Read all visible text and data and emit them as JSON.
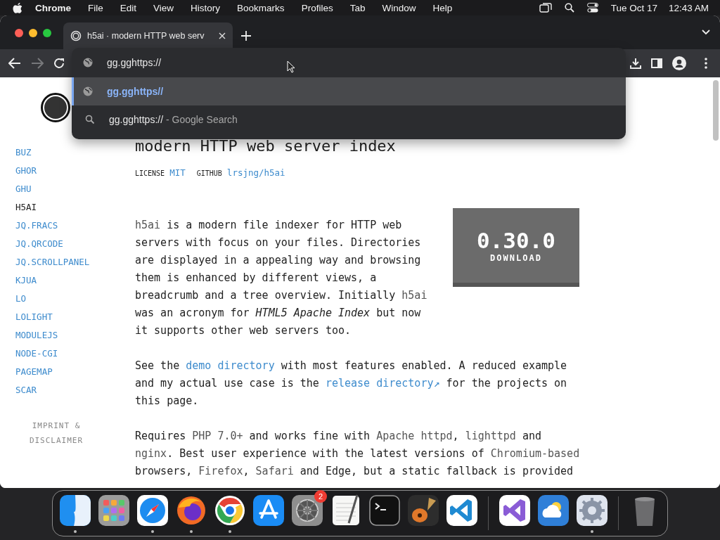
{
  "menubar": {
    "app": "Chrome",
    "menus": [
      "File",
      "Edit",
      "View",
      "History",
      "Bookmarks",
      "Profiles",
      "Tab",
      "Window",
      "Help"
    ],
    "date": "Tue Oct 17",
    "time": "12:43 AM"
  },
  "browser": {
    "tab": {
      "title": "h5ai · modern HTTP web serv",
      "selected": true
    },
    "forward_disabled": true,
    "omnibox": {
      "value": "gg.gghttps://"
    },
    "suggestions": [
      {
        "kind": "url",
        "text": "gg.gghttps//",
        "selected": true
      },
      {
        "kind": "search",
        "text": "gg.gghttps://",
        "suffix": " - Google Search",
        "selected": false
      }
    ]
  },
  "page": {
    "sidebar": {
      "items": [
        {
          "label": "BUZ",
          "selected": false
        },
        {
          "label": "GHOR",
          "selected": false
        },
        {
          "label": "GHU",
          "selected": false
        },
        {
          "label": "H5AI",
          "selected": true
        },
        {
          "label": "JQ.FRACS",
          "selected": false
        },
        {
          "label": "JQ.QRCODE",
          "selected": false
        },
        {
          "label": "JQ.SCROLLPANEL",
          "selected": false
        },
        {
          "label": "KJUA",
          "selected": false
        },
        {
          "label": "LO",
          "selected": false
        },
        {
          "label": "LOLIGHT",
          "selected": false
        },
        {
          "label": "MODULEJS",
          "selected": false
        },
        {
          "label": "NODE-CGI",
          "selected": false
        },
        {
          "label": "PAGEMAP",
          "selected": false
        },
        {
          "label": "SCAR",
          "selected": false
        }
      ],
      "footer": "IMPRINT & DISCLAIMER"
    },
    "heading": "modern HTTP web server index",
    "meta": [
      {
        "label": "LICENSE",
        "value": "MIT"
      },
      {
        "label": "GITHUB",
        "value": "lrsjng/h5ai"
      }
    ],
    "download": {
      "version": "0.30.0",
      "label": "DOWNLOAD"
    },
    "paragraphs": [
      [
        {
          "kind": "code",
          "text": "h5ai"
        },
        {
          "kind": "text",
          "text": " is a modern file indexer for HTTP web servers with focus on your files. Directories are displayed in a appealing way and browsing them is enhanced by different views, a breadcrumb and a tree overview. Initially "
        },
        {
          "kind": "code",
          "text": "h5ai"
        },
        {
          "kind": "text",
          "text": " was an acronym for "
        },
        {
          "kind": "em",
          "text": "HTML5 Apache Index"
        },
        {
          "kind": "text",
          "text": " but now it supports other web servers too."
        }
      ],
      [
        {
          "kind": "text",
          "text": "See the "
        },
        {
          "kind": "link",
          "text": "demo directory"
        },
        {
          "kind": "text",
          "text": " with most features enabled. A reduced example and my actual use case is the "
        },
        {
          "kind": "link",
          "text": "release directory↗"
        },
        {
          "kind": "text",
          "text": " for the projects on this page."
        }
      ],
      [
        {
          "kind": "text",
          "text": "Requires "
        },
        {
          "kind": "code",
          "text": "PHP 7.0+"
        },
        {
          "kind": "text",
          "text": " and works fine with "
        },
        {
          "kind": "code",
          "text": "Apache httpd"
        },
        {
          "kind": "text",
          "text": ", "
        },
        {
          "kind": "code",
          "text": "lighttpd"
        },
        {
          "kind": "text",
          "text": " and "
        },
        {
          "kind": "code",
          "text": "nginx"
        },
        {
          "kind": "text",
          "text": ". Best user experience with the latest versions of "
        },
        {
          "kind": "code",
          "text": "Chromium-based"
        },
        {
          "kind": "text",
          "text": " browsers, "
        },
        {
          "kind": "code",
          "text": "Firefox"
        },
        {
          "kind": "text",
          "text": ", "
        },
        {
          "kind": "code",
          "text": "Safari"
        },
        {
          "kind": "text",
          "text": " and Edge, but a static fallback is provided"
        }
      ]
    ]
  },
  "dock": [
    {
      "kind": "finder",
      "running": true
    },
    {
      "kind": "launchpad",
      "running": false
    },
    {
      "kind": "safari",
      "running": true
    },
    {
      "kind": "firefox",
      "running": true
    },
    {
      "kind": "chrome",
      "running": true
    },
    {
      "kind": "appstore",
      "running": false
    },
    {
      "kind": "settings",
      "running": false,
      "badge": "2"
    },
    {
      "kind": "textedit",
      "running": false
    },
    {
      "kind": "terminal",
      "running": false
    },
    {
      "kind": "guitar",
      "running": false
    },
    {
      "kind": "vscode",
      "running": false
    },
    {
      "kind": "separator"
    },
    {
      "kind": "vs",
      "running": false
    },
    {
      "kind": "weather",
      "running": false
    },
    {
      "kind": "gear",
      "running": true
    },
    {
      "kind": "separator"
    },
    {
      "kind": "trash",
      "running": false
    }
  ]
}
